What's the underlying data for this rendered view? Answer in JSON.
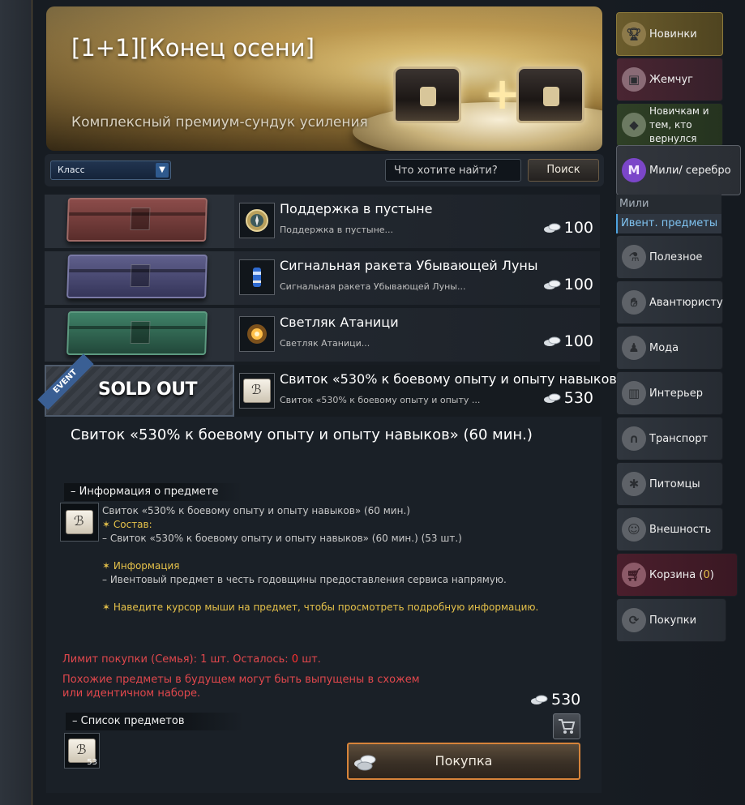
{
  "banner": {
    "title": "[1+1][Конец осени]",
    "subtitle": "Комплексный премиум-сундук усиления"
  },
  "filters": {
    "class_select": "Класс",
    "search_placeholder": "Что хотите найти?",
    "search_button": "Поиск"
  },
  "items": [
    {
      "name": "Поддержка в пустыне",
      "desc": "Поддержка в пустыне...",
      "price": "100",
      "box_color": "red"
    },
    {
      "name": "Сигнальная ракета Убывающей Луны",
      "desc": "Сигнальная ракета Убывающей Луны...",
      "price": "100",
      "box_color": "purple"
    },
    {
      "name": "Светляк Атаници",
      "desc": "Светляк Атаници...",
      "price": "100",
      "box_color": "green"
    },
    {
      "name": "Свиток «530% к боевому опыту и опыту навыков...",
      "desc": "Свиток «530% к боевому опыту и опыту ...",
      "price": "530",
      "sold_out": "SOLD OUT",
      "badge": "EVENT"
    }
  ],
  "detail": {
    "title": "Свиток «530% к боевому опыту и опыту навыков» (60 мин.)",
    "info_header": "– Информация о предмете",
    "info": {
      "line1": "Свиток «530% к боевому опыту и опыту навыков» (60 мин.)",
      "line2": "✶ Состав:",
      "line3": "– Свиток «530% к боевому опыту и опыту навыков» (60 мин.) (53 шт.)",
      "line4": "✶ Информация",
      "line5": "– Ивентовый предмет в честь годовщины предоставления сервиса напрямую.",
      "line6": "✶ Наведите курсор мыши на предмет, чтобы просмотреть подробную информацию."
    },
    "limit_prefix": "Лимит покупки (Семья): 1 шт. Осталось: ",
    "limit_remaining": "0",
    "limit_suffix": " шт.",
    "warning": "Похожие предметы в будущем могут быть выпущены в схожем или идентичном наборе.",
    "price": "530",
    "list_header": "– Список предметов",
    "list_count": "53",
    "buy_button": "Покупка"
  },
  "nav": {
    "new": "Новинки",
    "pearl": "Жемчуг",
    "newbie": "Новичкам и тем, кто вернулся",
    "miles": "Мили/ серебро",
    "sub_miles": "Мили",
    "sub_event": "Ивент. предметы",
    "useful": "Полезное",
    "adventurer": "Авантюристу",
    "fashion": "Мода",
    "interior": "Интерьер",
    "transport": "Транспорт",
    "pets": "Питомцы",
    "appearance": "Внешность",
    "cart_label": "Корзина (",
    "cart_count": "0",
    "cart_close": ")",
    "purchases": "Покупки"
  },
  "colors": {
    "accent_red": "#e0474c",
    "accent_yellow": "#e5c14a",
    "accent_blue": "#7fc3f1"
  }
}
